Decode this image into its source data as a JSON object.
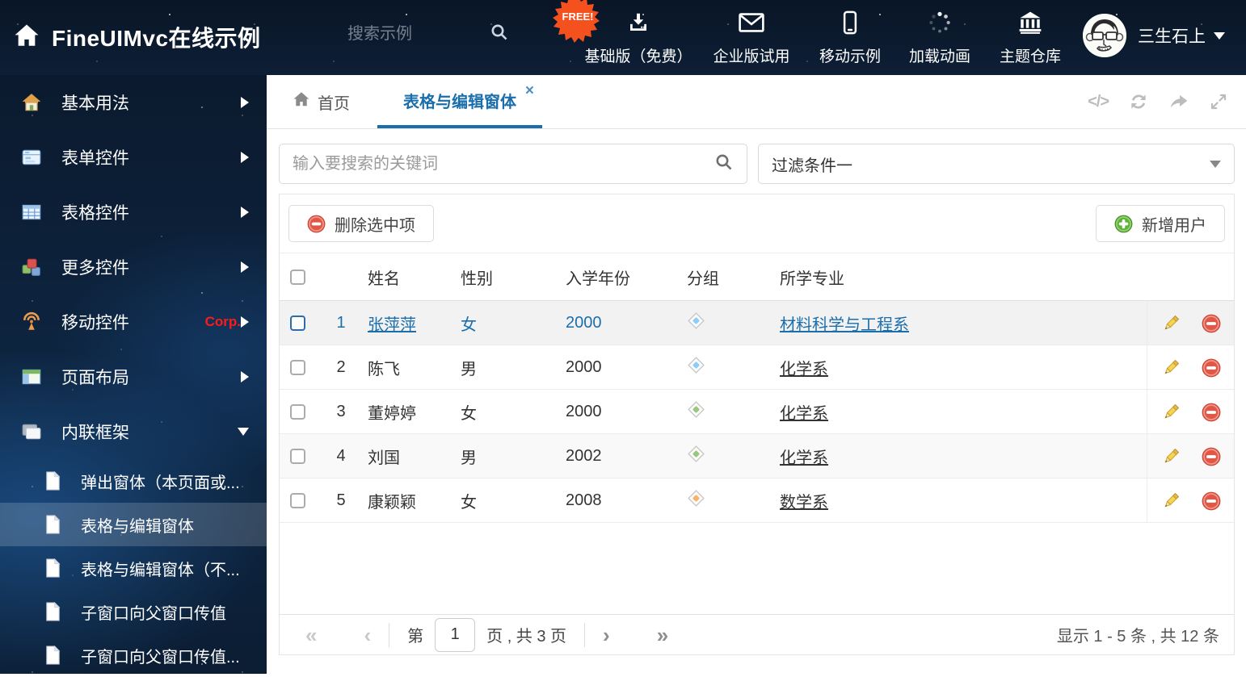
{
  "header": {
    "title": "FineUIMvc在线示例",
    "search_placeholder": "搜索示例",
    "free_badge": "FREE!",
    "nav_items": [
      {
        "icon": "download-icon",
        "label": "基础版（免费）"
      },
      {
        "icon": "envelope-icon",
        "label": "企业版试用"
      },
      {
        "icon": "mobile-icon",
        "label": "移动示例"
      },
      {
        "icon": "spinner-icon",
        "label": "加载动画"
      },
      {
        "icon": "bank-icon",
        "label": "主题仓库"
      }
    ],
    "username": "三生石上"
  },
  "sidebar": {
    "items": [
      {
        "icon": "home-icon",
        "label": "基本用法"
      },
      {
        "icon": "form-icon",
        "label": "表单控件"
      },
      {
        "icon": "grid-icon",
        "label": "表格控件"
      },
      {
        "icon": "cubes-icon",
        "label": "更多控件"
      },
      {
        "icon": "antenna-icon",
        "label": "移动控件",
        "badge": "Corp."
      },
      {
        "icon": "layout-icon",
        "label": "页面布局"
      },
      {
        "icon": "frames-icon",
        "label": "内联框架"
      }
    ],
    "subitems": [
      {
        "label": "弹出窗体（本页面或..."
      },
      {
        "label": "表格与编辑窗体"
      },
      {
        "label": "表格与编辑窗体（不..."
      },
      {
        "label": "子窗口向父窗口传值"
      },
      {
        "label": "子窗口向父窗口传值..."
      }
    ]
  },
  "tabs": {
    "home_label": "首页",
    "active_label": "表格与编辑窗体"
  },
  "filter_bar": {
    "search_placeholder": "输入要搜索的关键词",
    "filter_value": "过滤条件一"
  },
  "toolbar": {
    "delete_label": "删除选中项",
    "add_label": "新增用户"
  },
  "table": {
    "headers": {
      "name": "姓名",
      "gender": "性别",
      "year": "入学年份",
      "group": "分组",
      "major": "所学专业"
    },
    "rows": [
      {
        "num": "1",
        "name": "张萍萍",
        "gender": "女",
        "year": "2000",
        "tag": "blue",
        "major": "材料科学与工程系"
      },
      {
        "num": "2",
        "name": "陈飞",
        "gender": "男",
        "year": "2000",
        "tag": "blue",
        "major": "化学系"
      },
      {
        "num": "3",
        "name": "董婷婷",
        "gender": "女",
        "year": "2000",
        "tag": "green",
        "major": "化学系"
      },
      {
        "num": "4",
        "name": "刘国",
        "gender": "男",
        "year": "2002",
        "tag": "green",
        "major": "化学系"
      },
      {
        "num": "5",
        "name": "康颖颖",
        "gender": "女",
        "year": "2008",
        "tag": "orange",
        "major": "数学系"
      }
    ]
  },
  "pagination": {
    "prefix": "第",
    "page_value": "1",
    "suffix": "页 , 共 3 页",
    "summary": "显示 1 - 5 条 , 共 12 条"
  },
  "colors": {
    "accent_blue": "#1b6eac",
    "tag_blue": "#8ecdf5",
    "tag_green": "#96c97e",
    "tag_orange": "#f7b36b",
    "badge_orange": "#f4511e",
    "corp_red": "#ff1a1a",
    "delete_red": "#e15746",
    "add_green": "#5cb335"
  }
}
